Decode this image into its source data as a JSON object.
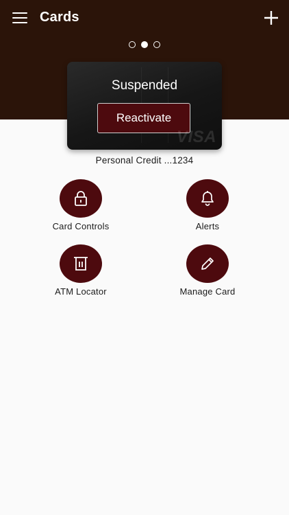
{
  "header": {
    "title": "Cards",
    "menu_icon": "hamburger-menu-icon",
    "add_icon": "plus-icon",
    "background_color": "#2b1409"
  },
  "carousel": {
    "page_count": 3,
    "active_index": 1
  },
  "card": {
    "status": "Suspended",
    "reactivate_label": "Reactivate",
    "network": "VISA",
    "name": "Personal Credit ...1234"
  },
  "actions": [
    {
      "label": "Card Controls",
      "icon": "lock-icon"
    },
    {
      "label": "Alerts",
      "icon": "bell-icon"
    },
    {
      "label": "ATM Locator",
      "icon": "atm-icon"
    },
    {
      "label": "Manage Card",
      "icon": "pencil-icon"
    }
  ],
  "colors": {
    "accent": "#4d0a0e",
    "background": "#fafafa",
    "text": "#1a1a1a"
  }
}
